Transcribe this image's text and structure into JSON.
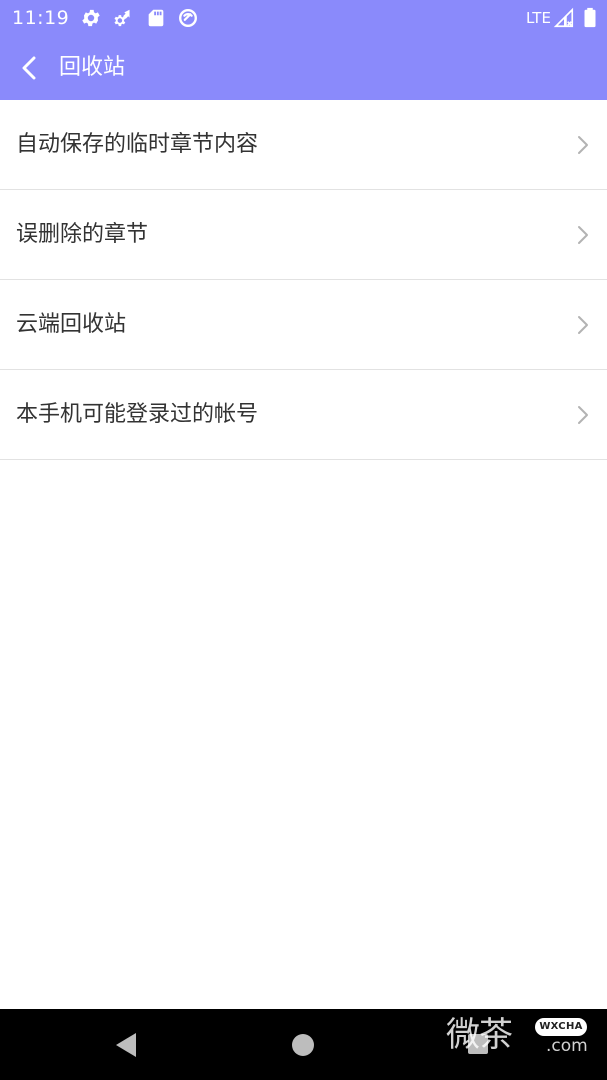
{
  "status_bar": {
    "time": "11:19",
    "network_label": "LTE",
    "icons": [
      "settings-gear-icon",
      "data-sync-icon",
      "sd-card-icon",
      "do-not-disturb-icon",
      "cellular-signal-icon",
      "battery-icon"
    ]
  },
  "app_bar": {
    "back_icon": "chevron-left-icon",
    "title": "回收站"
  },
  "menu": {
    "items": [
      {
        "label": "自动保存的临时章节内容",
        "icon": "chevron-right-icon"
      },
      {
        "label": "误删除的章节",
        "icon": "chevron-right-icon"
      },
      {
        "label": "云端回收站",
        "icon": "chevron-right-icon"
      },
      {
        "label": "本手机可能登录过的帐号",
        "icon": "chevron-right-icon"
      }
    ]
  },
  "nav_bar": {
    "buttons": [
      "back-triangle-icon",
      "home-circle-icon",
      "recents-square-icon"
    ]
  },
  "watermark": {
    "text_cn": "微茶",
    "badge": "WXCHA",
    "domain": ".com"
  },
  "colors": {
    "accent": "#8a8afb",
    "list_text": "#333333",
    "divider": "#e2e2e2",
    "chevron": "#b3b3b3",
    "nav_bar": "#000000"
  }
}
